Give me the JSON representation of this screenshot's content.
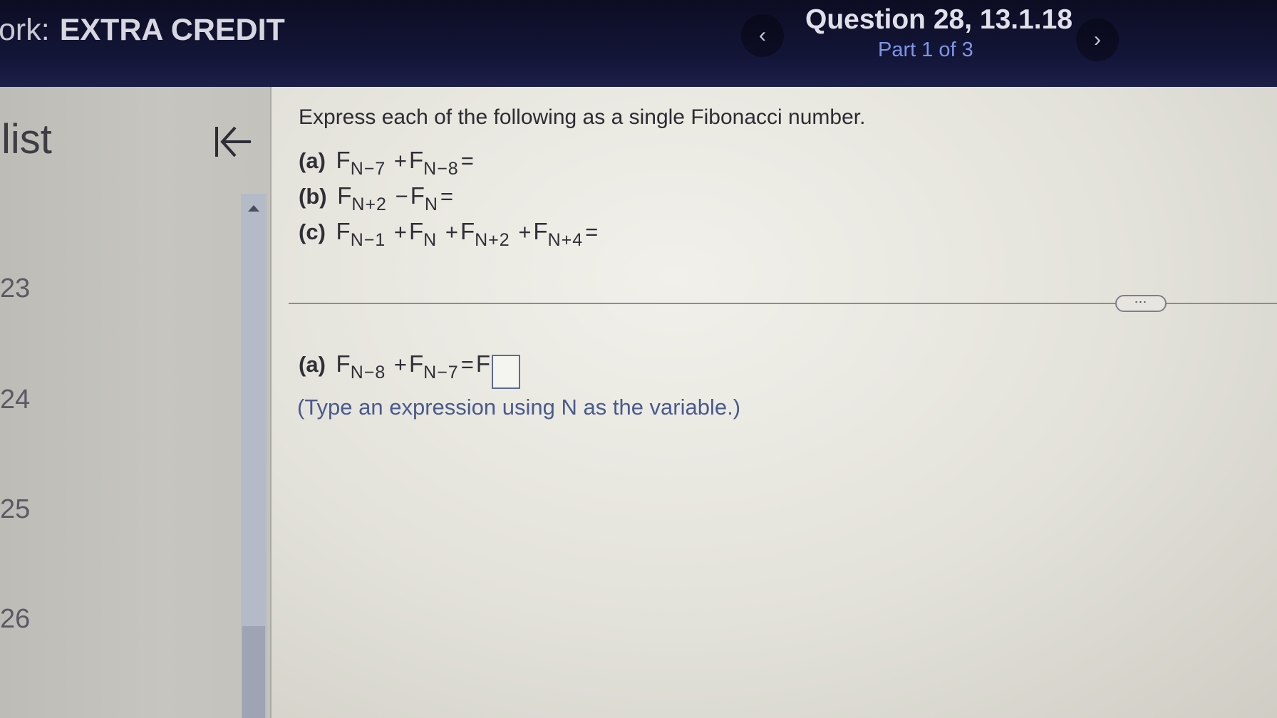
{
  "header": {
    "hw_prefix": "ork:",
    "hw_name": "EXTRA CREDIT",
    "question_title": "Question 28, 13.1.18",
    "question_part": "Part 1 of 3",
    "prev_icon": "‹",
    "next_icon": "›"
  },
  "sidebar": {
    "title": "list",
    "question_numbers": [
      "23",
      "24",
      "25",
      "26"
    ]
  },
  "problem": {
    "prompt": "Express each of the following as a single Fibonacci number.",
    "parts": [
      {
        "label": "(a)",
        "terms": [
          {
            "F": "F",
            "sub": "N−7"
          },
          {
            "op": "+"
          },
          {
            "F": "F",
            "sub": "N−8"
          }
        ],
        "eq": "="
      },
      {
        "label": "(b)",
        "terms": [
          {
            "F": "F",
            "sub": "N+2"
          },
          {
            "op": "−"
          },
          {
            "F": "F",
            "sub": "N"
          }
        ],
        "eq": "="
      },
      {
        "label": "(c)",
        "terms": [
          {
            "F": "F",
            "sub": "N−1"
          },
          {
            "op": "+"
          },
          {
            "F": "F",
            "sub": "N"
          },
          {
            "op": "+"
          },
          {
            "F": "F",
            "sub": "N+2"
          },
          {
            "op": "+"
          },
          {
            "F": "F",
            "sub": "N+4"
          }
        ],
        "eq": "="
      }
    ]
  },
  "more_button": "⋯",
  "answer": {
    "label": "(a)",
    "F1": "F",
    "sub1": "N−8",
    "op": "+",
    "F2": "F",
    "sub2": "N−7",
    "eq": "=",
    "F3": "F",
    "hint": "(Type an expression using N as the variable.)"
  }
}
